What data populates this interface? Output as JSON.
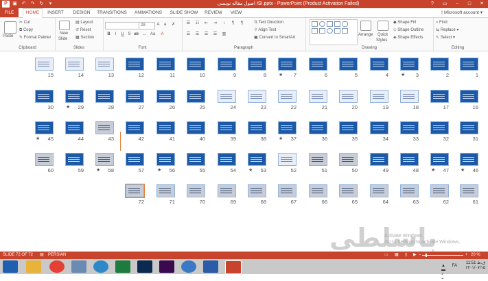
{
  "titlebar": {
    "title": "اصول مقاله نویسی ISI.pptx - PowerPoint (Product Activation Failed)",
    "app_icon": "P",
    "qat": [
      "save-icon",
      "undo-icon",
      "redo-icon",
      "refresh-icon",
      "customize-icon"
    ],
    "controls": [
      "?",
      "▭",
      "–",
      "□",
      "✕"
    ]
  },
  "tabs": [
    "FILE",
    "HOME",
    "INSERT",
    "DESIGN",
    "TRANSITIONS",
    "ANIMATIONS",
    "SLIDE SHOW",
    "REVIEW",
    "VIEW"
  ],
  "account": "Microsoft account",
  "ribbon": {
    "clipboard": {
      "paste": "Paste",
      "cut": "Cut",
      "copy": "Copy",
      "format_painter": "Format Painter",
      "label": "Clipboard"
    },
    "slides": {
      "new_slide_1": "New",
      "new_slide_2": "Slide",
      "layout": "Layout",
      "reset": "Reset",
      "section": "Section",
      "label": "Slides"
    },
    "font": {
      "size": "28",
      "label": "Font"
    },
    "paragraph": {
      "text_direction": "Text Direction",
      "align_text": "Align Text",
      "smartart": "Convert to SmartArt",
      "label": "Paragraph"
    },
    "drawing": {
      "arrange": "Arrange",
      "quick_styles_1": "Quick",
      "quick_styles_2": "Styles",
      "shape_fill": "Shape Fill",
      "shape_outline": "Shape Outline",
      "shape_effects": "Shape Effects",
      "label": "Drawing"
    },
    "editing": {
      "find": "Find",
      "replace": "Replace",
      "select": "Select",
      "label": "Editing"
    }
  },
  "slides": [
    {
      "row": 0,
      "items": [
        {
          "n": "15",
          "s": "light"
        },
        {
          "n": "14",
          "s": "light"
        },
        {
          "n": "13",
          "s": "light"
        },
        {
          "n": "12",
          "s": "blue"
        },
        {
          "n": "11",
          "s": "blue"
        },
        {
          "n": "10",
          "s": "blue"
        },
        {
          "n": "9",
          "s": "blue"
        },
        {
          "n": "8",
          "s": "blue"
        },
        {
          "n": "7",
          "s": "blue",
          "star": true
        },
        {
          "n": "6",
          "s": "blue"
        },
        {
          "n": "5",
          "s": "blue"
        },
        {
          "n": "4",
          "s": "blue"
        },
        {
          "n": "3",
          "s": "blue",
          "star": true
        },
        {
          "n": "2",
          "s": "blue"
        },
        {
          "n": "1",
          "s": "blue"
        }
      ]
    },
    {
      "row": 1,
      "items": [
        {
          "n": "30",
          "s": "blue"
        },
        {
          "n": "29",
          "s": "blue",
          "star": true
        },
        {
          "n": "28",
          "s": "blue"
        },
        {
          "n": "27",
          "s": "blue"
        },
        {
          "n": "26",
          "s": "blue"
        },
        {
          "n": "25",
          "s": "blue"
        },
        {
          "n": "24",
          "s": "light"
        },
        {
          "n": "23",
          "s": "light"
        },
        {
          "n": "22",
          "s": "light"
        },
        {
          "n": "21",
          "s": "light"
        },
        {
          "n": "20",
          "s": "light"
        },
        {
          "n": "19",
          "s": "light"
        },
        {
          "n": "18",
          "s": "light"
        },
        {
          "n": "17",
          "s": "blue"
        },
        {
          "n": "16",
          "s": "blue"
        }
      ]
    },
    {
      "row": 2,
      "items": [
        {
          "n": "45",
          "s": "blue",
          "star": true
        },
        {
          "n": "44",
          "s": "blue"
        },
        {
          "n": "43",
          "s": "gray"
        },
        {
          "n": "42",
          "s": "blue"
        },
        {
          "n": "41",
          "s": "blue"
        },
        {
          "n": "40",
          "s": "blue"
        },
        {
          "n": "39",
          "s": "blue"
        },
        {
          "n": "38",
          "s": "blue"
        },
        {
          "n": "37",
          "s": "blue",
          "star": true
        },
        {
          "n": "36",
          "s": "blue"
        },
        {
          "n": "35",
          "s": "blue"
        },
        {
          "n": "34",
          "s": "blue"
        },
        {
          "n": "33",
          "s": "blue"
        },
        {
          "n": "32",
          "s": "blue"
        },
        {
          "n": "31",
          "s": "blue"
        }
      ]
    },
    {
      "row": 3,
      "items": [
        {
          "n": "60",
          "s": "gray"
        },
        {
          "n": "59",
          "s": "blue"
        },
        {
          "n": "58",
          "s": "gray",
          "star": true
        },
        {
          "n": "57",
          "s": "blue"
        },
        {
          "n": "56",
          "s": "blue",
          "star": true
        },
        {
          "n": "55",
          "s": "blue"
        },
        {
          "n": "54",
          "s": "blue"
        },
        {
          "n": "53",
          "s": "blue",
          "star": true
        },
        {
          "n": "52",
          "s": "light"
        },
        {
          "n": "51",
          "s": "gray"
        },
        {
          "n": "50",
          "s": "gray"
        },
        {
          "n": "49",
          "s": "blue"
        },
        {
          "n": "48",
          "s": "blue"
        },
        {
          "n": "47",
          "s": "blue",
          "star": true
        },
        {
          "n": "46",
          "s": "blue",
          "star": true
        }
      ]
    },
    {
      "row": 4,
      "items": [
        {
          "n": "72",
          "s": "gray",
          "sel": true
        },
        {
          "n": "71",
          "s": "gray"
        },
        {
          "n": "70",
          "s": "gray"
        },
        {
          "n": "69",
          "s": "gray"
        },
        {
          "n": "68",
          "s": "gray"
        },
        {
          "n": "67",
          "s": "gray"
        },
        {
          "n": "66",
          "s": "gray"
        },
        {
          "n": "65",
          "s": "gray"
        },
        {
          "n": "64",
          "s": "gray"
        },
        {
          "n": "63",
          "s": "gray"
        },
        {
          "n": "62",
          "s": "gray"
        },
        {
          "n": "61",
          "s": "gray"
        }
      ]
    }
  ],
  "watermark": "باسلطی",
  "activate": {
    "line1": "Activate Windows",
    "line2": "Go to Settings to activate Windows."
  },
  "status": {
    "slide": "SLIDE 72 OF 72",
    "language": "PERSIAN",
    "zoom": "20 %"
  },
  "taskbar": {
    "apps": [
      "start-icon",
      "explorer-icon",
      "chrome-icon",
      "network-icon",
      "sync-icon",
      "excel-icon",
      "photoshop-icon",
      "premiere-icon",
      "chat-icon",
      "word-icon",
      "powerpoint-icon"
    ],
    "lang": "FA",
    "time": "11:51 ق.ظ",
    "date": "۱۴۰۱/۰۷/۱۵"
  }
}
